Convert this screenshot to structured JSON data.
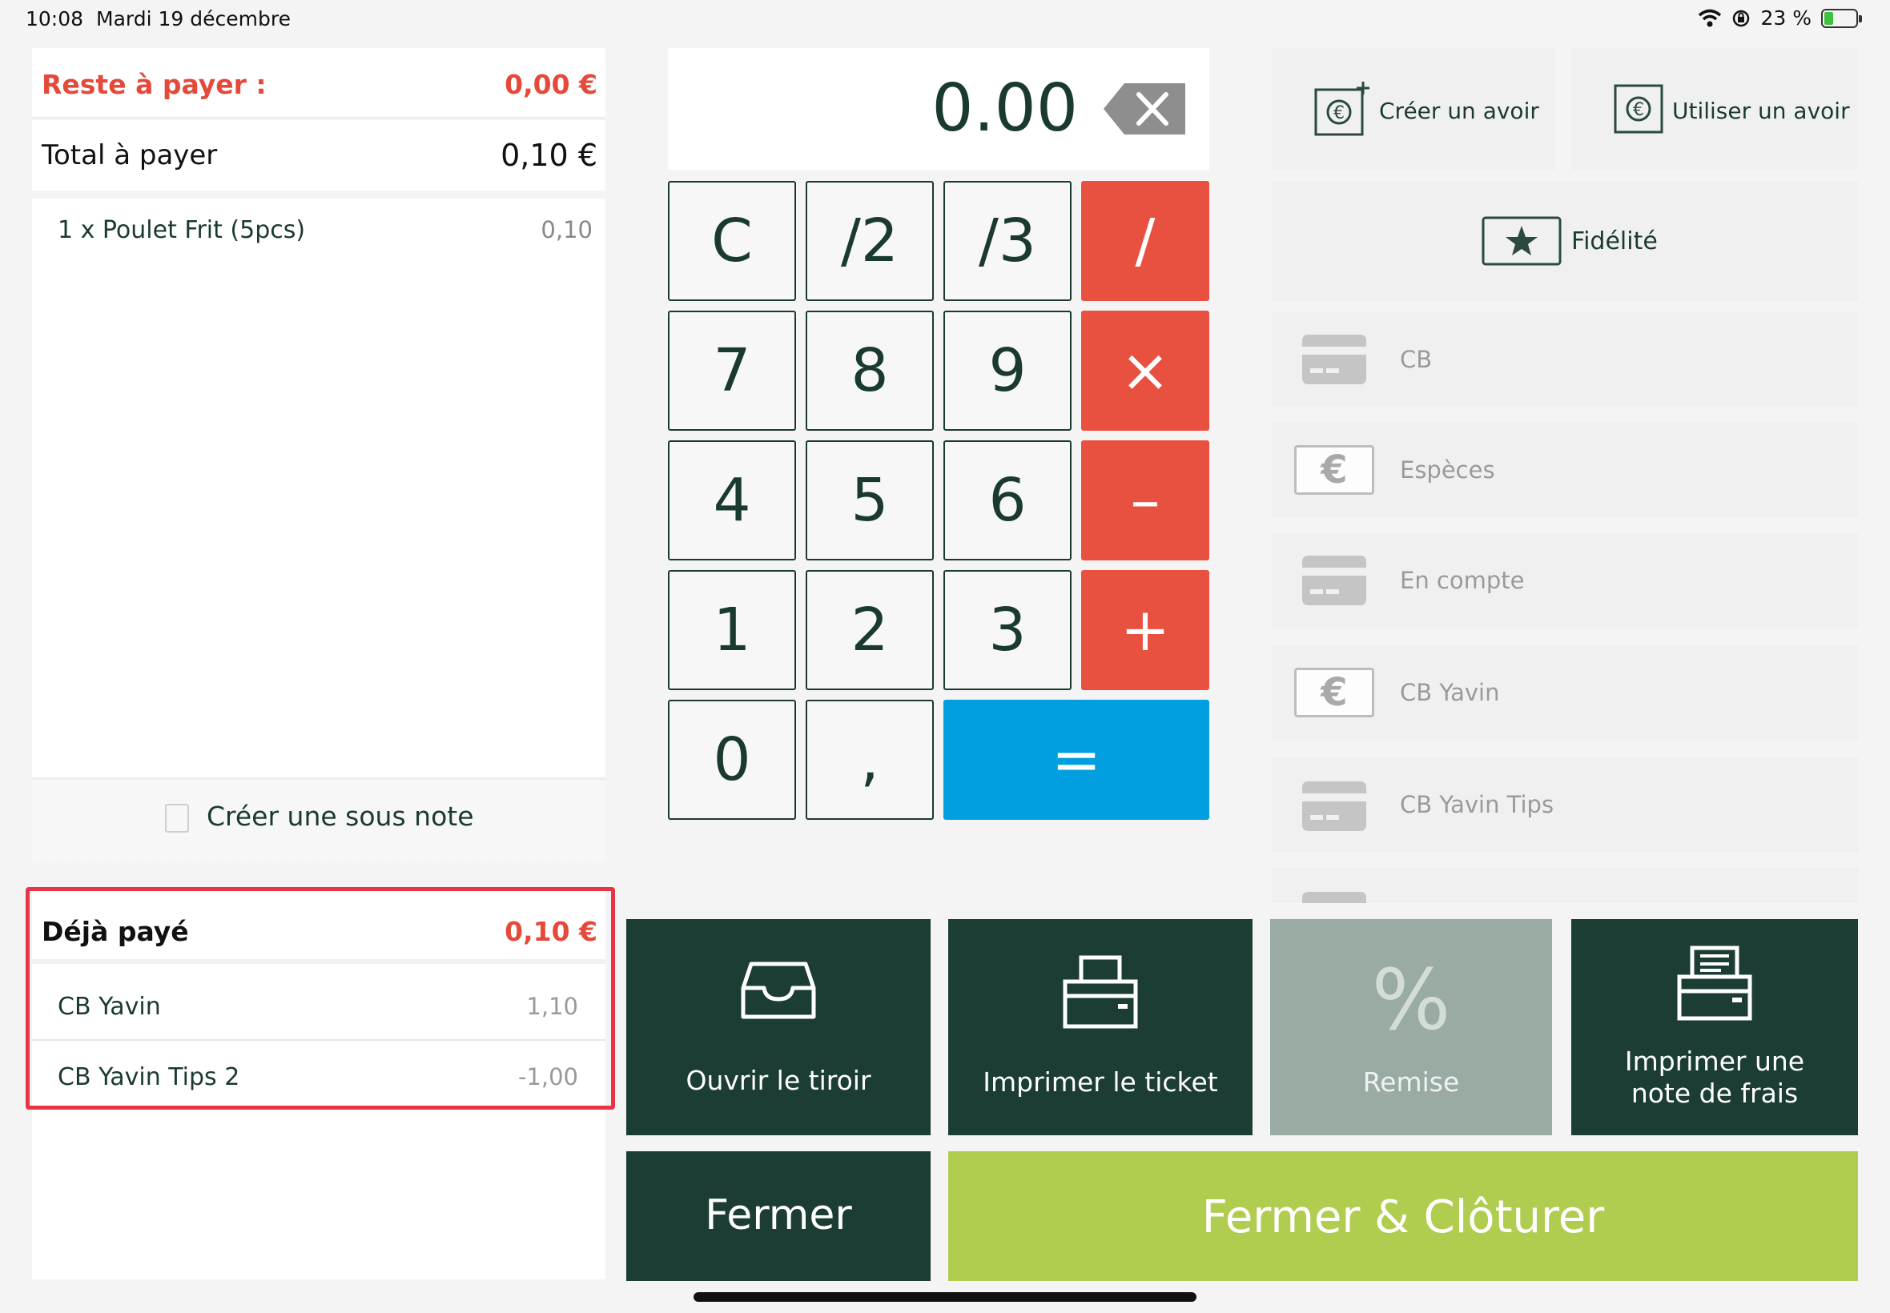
{
  "status": {
    "time": "10:08",
    "date": "Mardi 19 décembre",
    "battery": "23 %",
    "battery_level": 0.23,
    "icons": [
      "wifi-icon",
      "orientation-lock-icon",
      "battery-charging-icon"
    ]
  },
  "order": {
    "remaining_label": "Reste à payer :",
    "remaining_value": "0,00 €",
    "total_label": "Total à payer",
    "total_value": "0,10 €",
    "items": [
      {
        "label": "1 x Poulet Frit (5pcs)",
        "price": "0,10"
      }
    ],
    "sub_note_label": "Créer une sous note"
  },
  "paid": {
    "label": "Déjà payé",
    "value": "0,10 €",
    "rows": [
      {
        "name": "CB Yavin",
        "amount": "1,10"
      },
      {
        "name": "CB Yavin Tips 2",
        "amount": "-1,00"
      }
    ]
  },
  "calculator": {
    "display": "0.00",
    "keys": {
      "c": "C",
      "half": "/2",
      "third": "/3",
      "div": "/",
      "k7": "7",
      "k8": "8",
      "k9": "9",
      "mul": "×",
      "k4": "4",
      "k5": "5",
      "k6": "6",
      "sub": "–",
      "k1": "1",
      "k2": "2",
      "k3": "3",
      "add": "+",
      "k0": "0",
      "comma": ",",
      "eq": "="
    }
  },
  "side": {
    "create_credit": "Créer un avoir",
    "use_credit": "Utiliser un avoir",
    "loyalty": "Fidélité",
    "payment_methods": [
      {
        "label": "CB",
        "icon": "card-icon"
      },
      {
        "label": "Espèces",
        "icon": "cash-icon"
      },
      {
        "label": "En compte",
        "icon": "card-icon"
      },
      {
        "label": "CB Yavin",
        "icon": "cash-icon"
      },
      {
        "label": "CB Yavin Tips",
        "icon": "card-icon"
      }
    ]
  },
  "actions": {
    "open_drawer": "Ouvrir le tiroir",
    "print_ticket": "Imprimer le ticket",
    "discount": "Remise",
    "discount_symbol": "%",
    "print_expense": "Imprimer une note de frais",
    "close": "Fermer",
    "close_and_settle": "Fermer & Clôturer"
  },
  "colors": {
    "accent_red": "#e8513f",
    "dark_green": "#1b3d34",
    "lime": "#b0cd4f",
    "blue": "#019fe0",
    "highlight": "#e73547"
  }
}
